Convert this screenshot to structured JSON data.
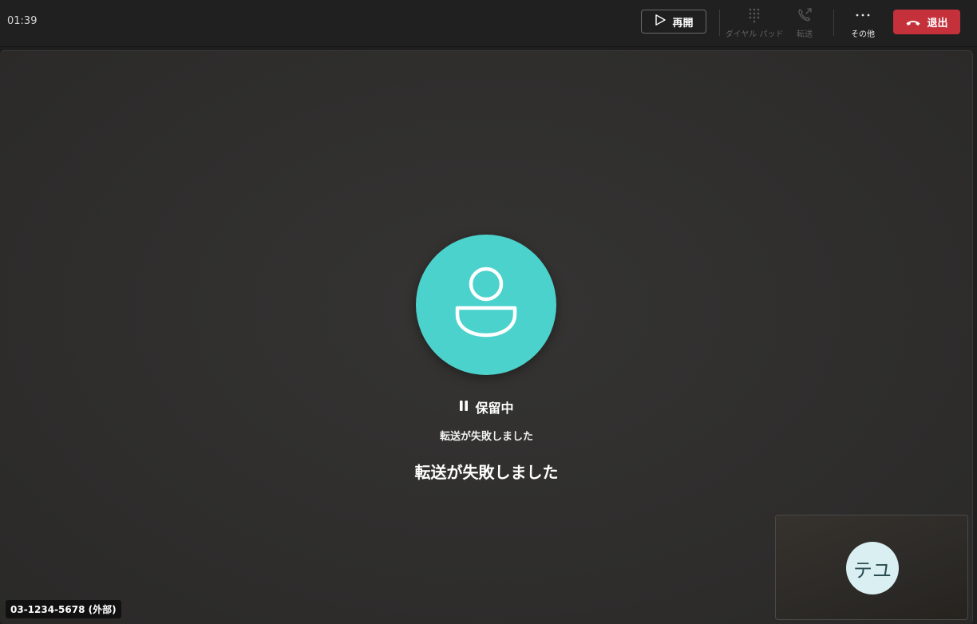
{
  "call": {
    "timer": "01:39",
    "status_label": "保留中",
    "sub_message": "転送が失敗しました",
    "main_message": "転送が失敗しました",
    "caller_label": "03-1234-5678 (外部)"
  },
  "toolbar": {
    "resume_label": "再開",
    "dialpad_label": "ダイヤル パッド",
    "transfer_label": "転送",
    "more_label": "その他",
    "leave_label": "退出"
  },
  "self_view": {
    "initials": "テユ"
  },
  "colors": {
    "avatar_accent": "#4cd2cd",
    "leave_red": "#c4313b",
    "self_avatar_bg": "#d9eff2"
  },
  "icons": [
    "play-icon",
    "dialpad-icon",
    "transfer-call-icon",
    "more-icon",
    "hang-up-icon",
    "person-icon",
    "pause-icon"
  ]
}
